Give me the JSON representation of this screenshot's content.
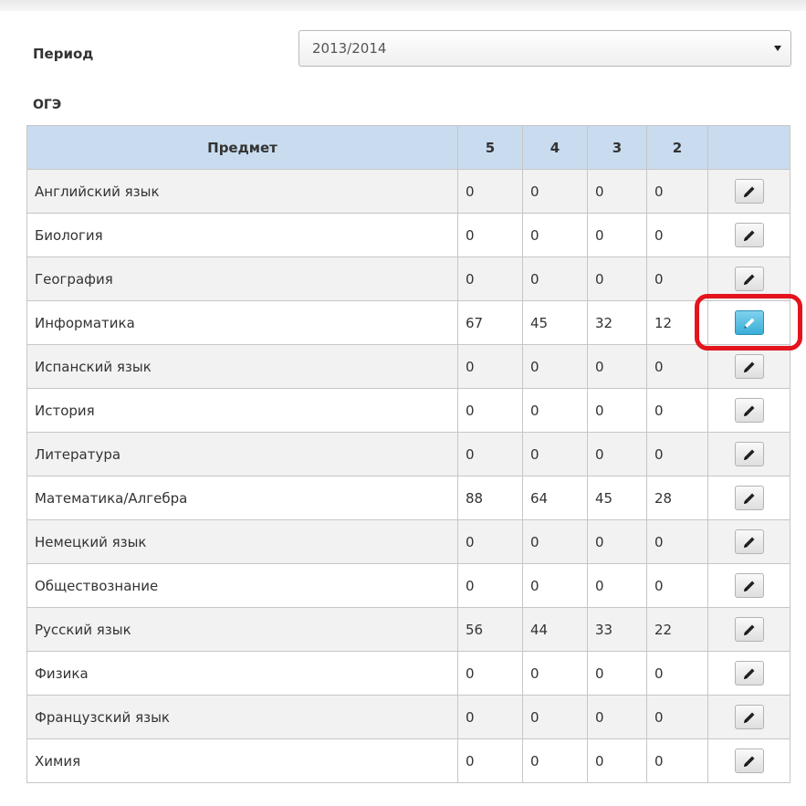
{
  "filter": {
    "period_label": "Период",
    "period_value": "2013/2014"
  },
  "section_title": "ОГЭ",
  "table": {
    "headers": [
      "Предмет",
      "5",
      "4",
      "3",
      "2",
      ""
    ],
    "rows": [
      {
        "subject": "Английский язык",
        "g5": "0",
        "g4": "0",
        "g3": "0",
        "g2": "0"
      },
      {
        "subject": "Биология",
        "g5": "0",
        "g4": "0",
        "g3": "0",
        "g2": "0"
      },
      {
        "subject": "География",
        "g5": "0",
        "g4": "0",
        "g3": "0",
        "g2": "0"
      },
      {
        "subject": "Информатика",
        "g5": "67",
        "g4": "45",
        "g3": "32",
        "g2": "12"
      },
      {
        "subject": "Испанский язык",
        "g5": "0",
        "g4": "0",
        "g3": "0",
        "g2": "0"
      },
      {
        "subject": "История",
        "g5": "0",
        "g4": "0",
        "g3": "0",
        "g2": "0"
      },
      {
        "subject": "Литература",
        "g5": "0",
        "g4": "0",
        "g3": "0",
        "g2": "0"
      },
      {
        "subject": "Математика/Алгебра",
        "g5": "88",
        "g4": "64",
        "g3": "45",
        "g2": "28"
      },
      {
        "subject": "Немецкий язык",
        "g5": "0",
        "g4": "0",
        "g3": "0",
        "g2": "0"
      },
      {
        "subject": "Обществознание",
        "g5": "0",
        "g4": "0",
        "g3": "0",
        "g2": "0"
      },
      {
        "subject": "Русский язык",
        "g5": "56",
        "g4": "44",
        "g3": "33",
        "g2": "22"
      },
      {
        "subject": "Физика",
        "g5": "0",
        "g4": "0",
        "g3": "0",
        "g2": "0"
      },
      {
        "subject": "Французский язык",
        "g5": "0",
        "g4": "0",
        "g3": "0",
        "g2": "0"
      },
      {
        "subject": "Химия",
        "g5": "0",
        "g4": "0",
        "g3": "0",
        "g2": "0"
      }
    ],
    "active_row": 3,
    "edit_icon": "pencil-icon"
  },
  "colors": {
    "header_bg": "#c9dcef",
    "active_button": "#3aaed8",
    "highlight": "#e3141d"
  }
}
